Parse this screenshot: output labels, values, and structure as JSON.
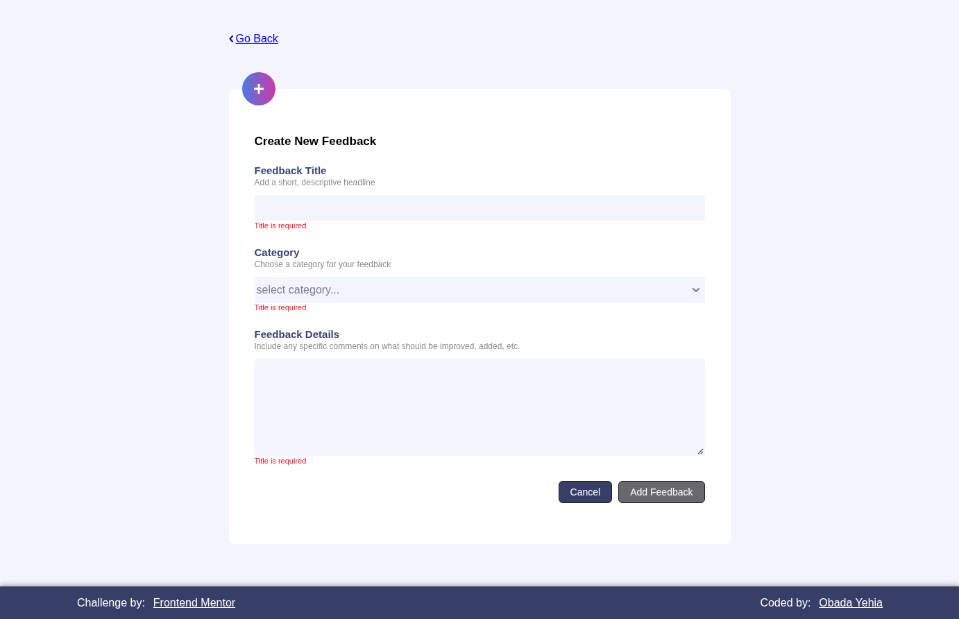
{
  "back_link": {
    "label": "Go Back"
  },
  "form": {
    "title": "Create New Feedback",
    "fields": [
      {
        "kind": "text",
        "label": "Feedback Title",
        "hint": "Add a short, descriptive headline",
        "error": "Title is required"
      },
      {
        "kind": "select",
        "label": "Category",
        "hint": "Choose a category for your feedback",
        "placeholder": "select category...",
        "error": "Title is required"
      },
      {
        "kind": "textarea",
        "label": "Feedback Details",
        "hint": "Include any specific comments on what should be improved, added, etc.",
        "error": "Title is required"
      }
    ],
    "buttons": [
      {
        "kind": "cancel",
        "label": "Cancel"
      },
      {
        "kind": "submit",
        "label": "Add Feedback"
      }
    ]
  },
  "footer": {
    "credits": [
      {
        "prefix": "Challenge by:",
        "link": "Frontend Mentor"
      },
      {
        "prefix": "Coded by:",
        "link": "Obada Yehia"
      }
    ]
  }
}
